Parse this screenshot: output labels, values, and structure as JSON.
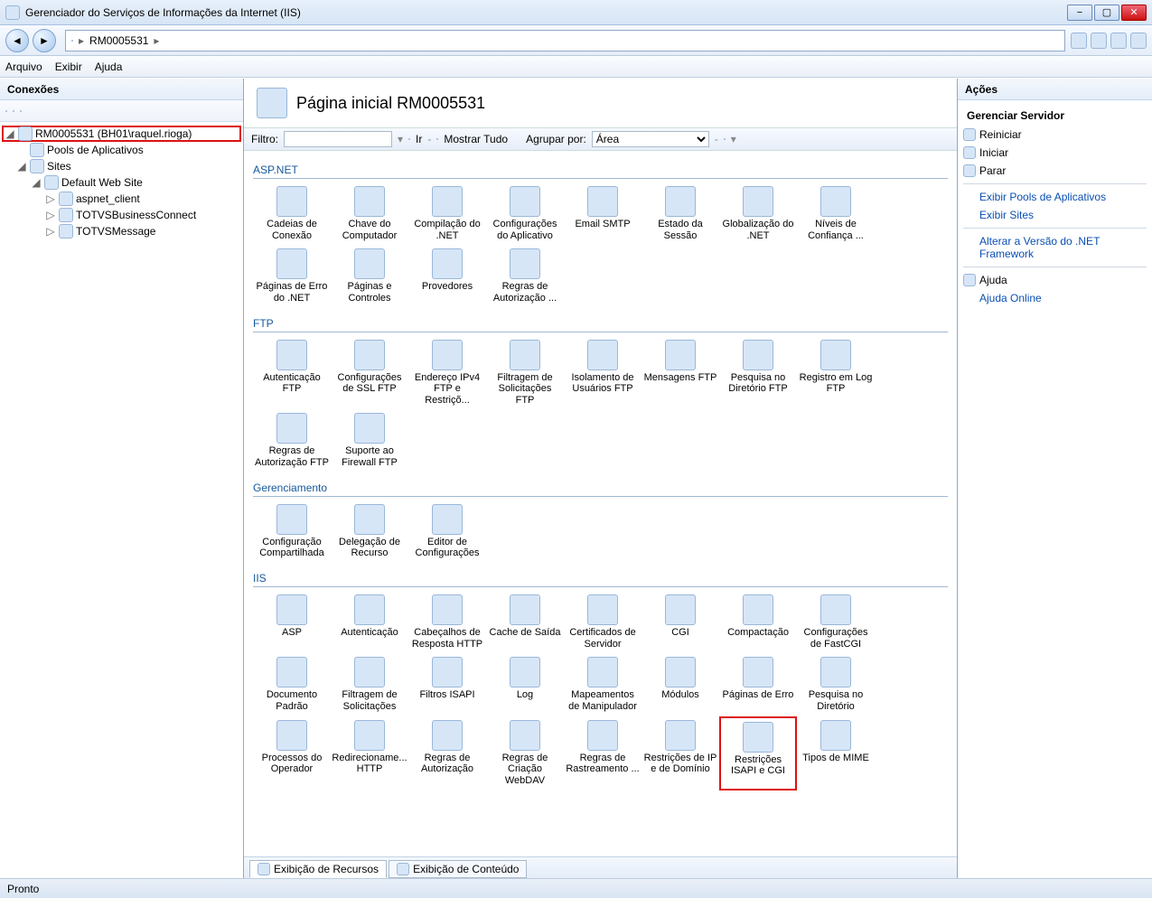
{
  "window": {
    "title": "Gerenciador do Serviços de Informações da Internet (IIS)"
  },
  "address": {
    "crumb": "RM0005531",
    "sep": "▸"
  },
  "menu": {
    "file": "Arquivo",
    "view": "Exibir",
    "help": "Ajuda"
  },
  "connections": {
    "title": "Conexões",
    "tree": {
      "root": "RM0005531 (BH01\\raquel.rioga)",
      "pools": "Pools de Aplicativos",
      "sites": "Sites",
      "default_site": "Default Web Site",
      "children": [
        "aspnet_client",
        "TOTVSBusinessConnect",
        "TOTVSMessage"
      ]
    }
  },
  "main": {
    "title": "Página inicial RM0005531",
    "filter_label": "Filtro:",
    "go": "Ir",
    "showall": "Mostrar Tudo",
    "groupby_label": "Agrupar por:",
    "groupby_value": "Área"
  },
  "groups": [
    {
      "title": "ASP.NET",
      "items": [
        "Cadeias de Conexão",
        "Chave do Computador",
        "Compilação do .NET",
        "Configurações do Aplicativo",
        "Email SMTP",
        "Estado da Sessão",
        "Globalização do .NET",
        "Níveis de Confiança ...",
        "Páginas de Erro do .NET",
        "Páginas e Controles",
        "Provedores",
        "Regras de Autorização ..."
      ]
    },
    {
      "title": "FTP",
      "items": [
        "Autenticação FTP",
        "Configurações de SSL FTP",
        "Endereço IPv4 FTP e Restriçõ...",
        "Filtragem de Solicitações FTP",
        "Isolamento de Usuários FTP",
        "Mensagens FTP",
        "Pesquisa no Diretório FTP",
        "Registro em Log FTP",
        "Regras de Autorização FTP",
        "Suporte ao Firewall FTP"
      ]
    },
    {
      "title": "Gerenciamento",
      "items": [
        "Configuração Compartilhada",
        "Delegação de Recurso",
        "Editor de Configurações"
      ]
    },
    {
      "title": "IIS",
      "items": [
        "ASP",
        "Autenticação",
        "Cabeçalhos de Resposta HTTP",
        "Cache de Saída",
        "Certificados de Servidor",
        "CGI",
        "Compactação",
        "Configurações de FastCGI",
        "Documento Padrão",
        "Filtragem de Solicitações",
        "Filtros ISAPI",
        "Log",
        "Mapeamentos de Manipulador",
        "Módulos",
        "Páginas de Erro",
        "Pesquisa no Diretório",
        "Processos do Operador",
        "Redirecioname... HTTP",
        "Regras de Autorização",
        "Regras de Criação WebDAV",
        "Regras de Rastreamento ...",
        "Restrições de IP e de Domínio",
        "Restrições ISAPI e CGI",
        "Tipos de MIME"
      ]
    }
  ],
  "highlighted_item": "Restrições ISAPI e CGI",
  "view_tabs": {
    "features": "Exibição de Recursos",
    "content": "Exibição de Conteúdo"
  },
  "actions": {
    "title": "Ações",
    "subtitle": "Gerenciar Servidor",
    "items": [
      {
        "label": "Reiniciar",
        "blue": false
      },
      {
        "label": "Iniciar",
        "blue": false
      },
      {
        "label": "Parar",
        "blue": false
      }
    ],
    "links": [
      "Exibir Pools de Aplicativos",
      "Exibir Sites",
      "Alterar a Versão do .NET Framework"
    ],
    "help": "Ajuda",
    "help_online": "Ajuda Online"
  },
  "status": "Pronto"
}
